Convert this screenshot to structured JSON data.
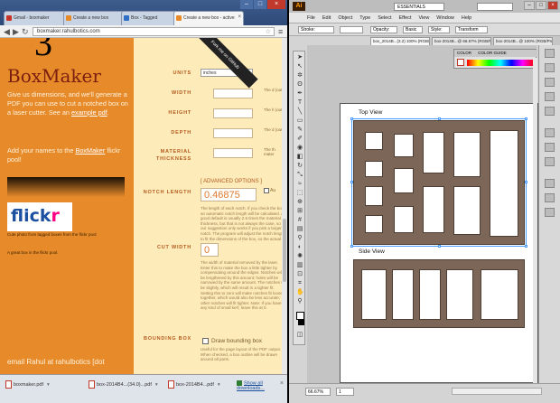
{
  "chrome": {
    "tabs": [
      {
        "label": "Gmail - boxmaker"
      },
      {
        "label": "Create a new box"
      },
      {
        "label": "Box - Tagged"
      },
      {
        "label": "Create a new box - active"
      }
    ],
    "address": "boxmaker.rahulbotics.com",
    "page": {
      "step_number": "3",
      "title": "BoxMaker",
      "intro_pre": "Give us dimensions, and we'll generate a PDF you can use to cut a notched box on a laser cutter. See an ",
      "intro_link": "example pdf",
      "intro_post": ".",
      "icon_pre": "Add your names to the ",
      "icon_link": "BoxMaker",
      "icon_post": " flickr pool!",
      "flickr_cap": "Cute photo from tagged boxes from the flickr pool",
      "flickr_cap2": "A great box in the flickr pool.",
      "ribbon": "Fork me on GitHub",
      "form": {
        "units_label": "UNITS",
        "units_value": "inches",
        "width_label": "WIDTH",
        "height_label": "HEIGHT",
        "depth_label": "DEPTH",
        "thickness_label": "MATERIAL THICKNESS",
        "notch_label": "NOTCH LENGTH",
        "notch_value": "0.46875",
        "advanced_link": "[ ADVANCED OPTIONS ]",
        "auto_label": "Au",
        "notch_desc": "The length of each notch. If you check the box an automatic notch length will be calculated. A good default is usually 2.5 times the material thickness, but that is not always the case, so our suggestion only works if you pick a larger notch. The program will adjust the notch length to fit the dimensions of the box, so the actual notch lengths may be shorter than you enter.",
        "cut_label": "CUT WIDTH",
        "cut_value": "0",
        "cut_desc": "The width of material removed by the laser. Enter this to make the box a little tighter by compensating around the edges. Notches will be lengthened by this amount; holes will be narrowed by the same amount. The notches will be slightly, which will result in a tighter fit. Setting this to zero will make notches fit loosely together, which would also be less accurate; other notches will fit tighter. Note: If you have any kind of small kerf, leave this at 0.",
        "bbox_label": "BOUNDING BOX",
        "bbox_check": "Draw bounding box",
        "bbox_desc": "Useful for the page layout of the PDF output. When checked, a box outline will be drawn around all parts.",
        "help_width": "The d (outsi",
        "help_height": "The h (outsi",
        "help_depth": "The d (outsi",
        "help_thick": "The th mater"
      },
      "bottom_text": "email Rahul at rahulbotics [dot"
    },
    "downloads": [
      {
        "name": "boxmaker.pdf"
      },
      {
        "name": "box-2014B4...(34.0)...pdf"
      },
      {
        "name": "box-2014B4...pdf"
      }
    ],
    "show_all": "Show all downloads..."
  },
  "illustrator": {
    "logo": "Ai",
    "workspace": "ESSENTIALS",
    "menu": [
      "File",
      "Edit",
      "Object",
      "Type",
      "Select",
      "Effect",
      "View",
      "Window",
      "Help"
    ],
    "control": {
      "stroke": "Stroke:",
      "opacity": "Opacity:",
      "style": "Style:",
      "basic": "Basic",
      "transform": "Transform"
    },
    "doc_tabs": [
      {
        "label": "box_2014B...(3.2) 100% (RGB/Preview)"
      },
      {
        "label": "box-2014B...@ 66.67% (RGB/Preview)"
      },
      {
        "label": "box-2014B...@ 100% (RGB/Preview)"
      }
    ],
    "top_view_label": "Top View",
    "side_view_label": "Side View",
    "color_panel": {
      "tab1": "COLOR",
      "tab2": "COLOR GUIDE"
    },
    "status": {
      "zoom": "66.67%",
      "page": "1"
    }
  }
}
